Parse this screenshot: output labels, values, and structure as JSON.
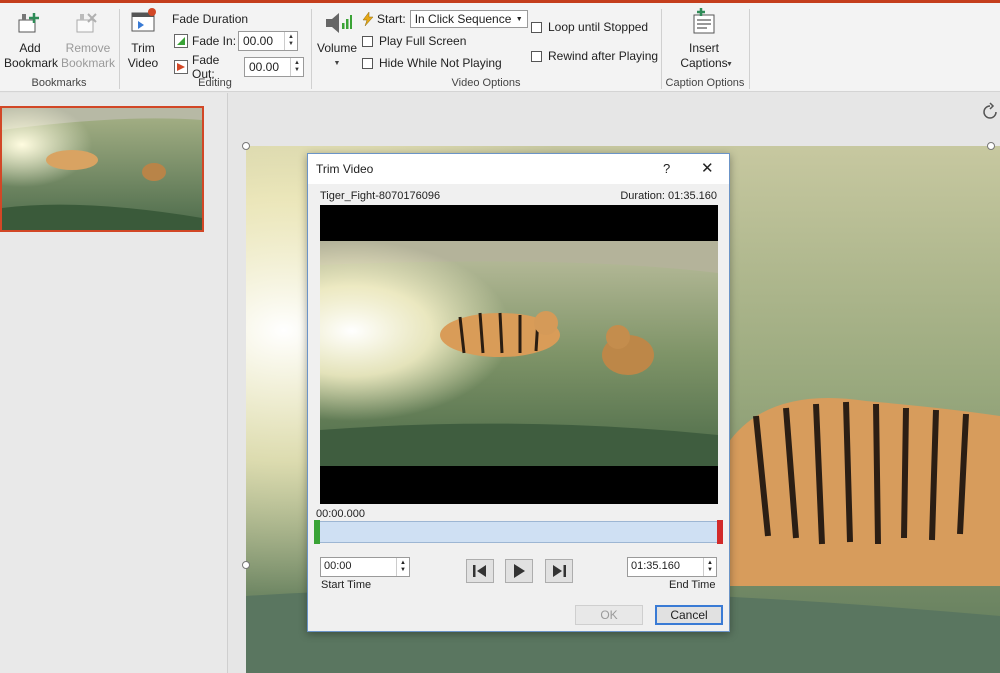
{
  "ribbon": {
    "bookmarks": {
      "add_label": "Add Bookmark",
      "remove_label": "Remove Bookmark",
      "group_label": "Bookmarks"
    },
    "editing": {
      "trim_label": "Trim Video",
      "fade_duration_label": "Fade Duration",
      "fade_in_label": "Fade In:",
      "fade_in_value": "00.00",
      "fade_out_label": "Fade Out:",
      "fade_out_value": "00.00",
      "group_label": "Editing"
    },
    "video_options": {
      "volume_label": "Volume",
      "start_label": "Start:",
      "start_value": "In Click Sequence",
      "play_full_screen": "Play Full Screen",
      "hide_while_not_playing": "Hide While Not Playing",
      "loop_until_stopped": "Loop until Stopped",
      "rewind_after_playing": "Rewind after Playing",
      "group_label": "Video Options"
    },
    "caption_options": {
      "insert_captions_label": "Insert Captions",
      "group_label": "Caption Options"
    }
  },
  "dialog": {
    "title": "Trim Video",
    "help": "?",
    "close": "✕",
    "file_name": "Tiger_Fight-8070176096",
    "duration": "Duration: 01:35.160",
    "current_time": "00:00.000",
    "start_time_value": "00:00",
    "start_time_label": "Start Time",
    "end_time_value": "01:35.160",
    "end_time_label": "End Time",
    "ok_label": "OK",
    "cancel_label": "Cancel"
  },
  "colors": {
    "accent": "#c43e1c",
    "selection_border": "#d24726",
    "dialog_border": "#6b94c7",
    "timeline_fill": "#cfe0f3",
    "start_marker": "#3aa336",
    "end_marker": "#d22a2a"
  },
  "icons": [
    "add-bookmark-icon",
    "remove-bookmark-icon",
    "trim-video-icon",
    "fade-in-icon",
    "fade-out-icon",
    "volume-icon",
    "start-lightning-icon",
    "insert-captions-icon",
    "previous-frame-icon",
    "play-icon",
    "next-frame-icon",
    "rotate-handle-icon"
  ]
}
